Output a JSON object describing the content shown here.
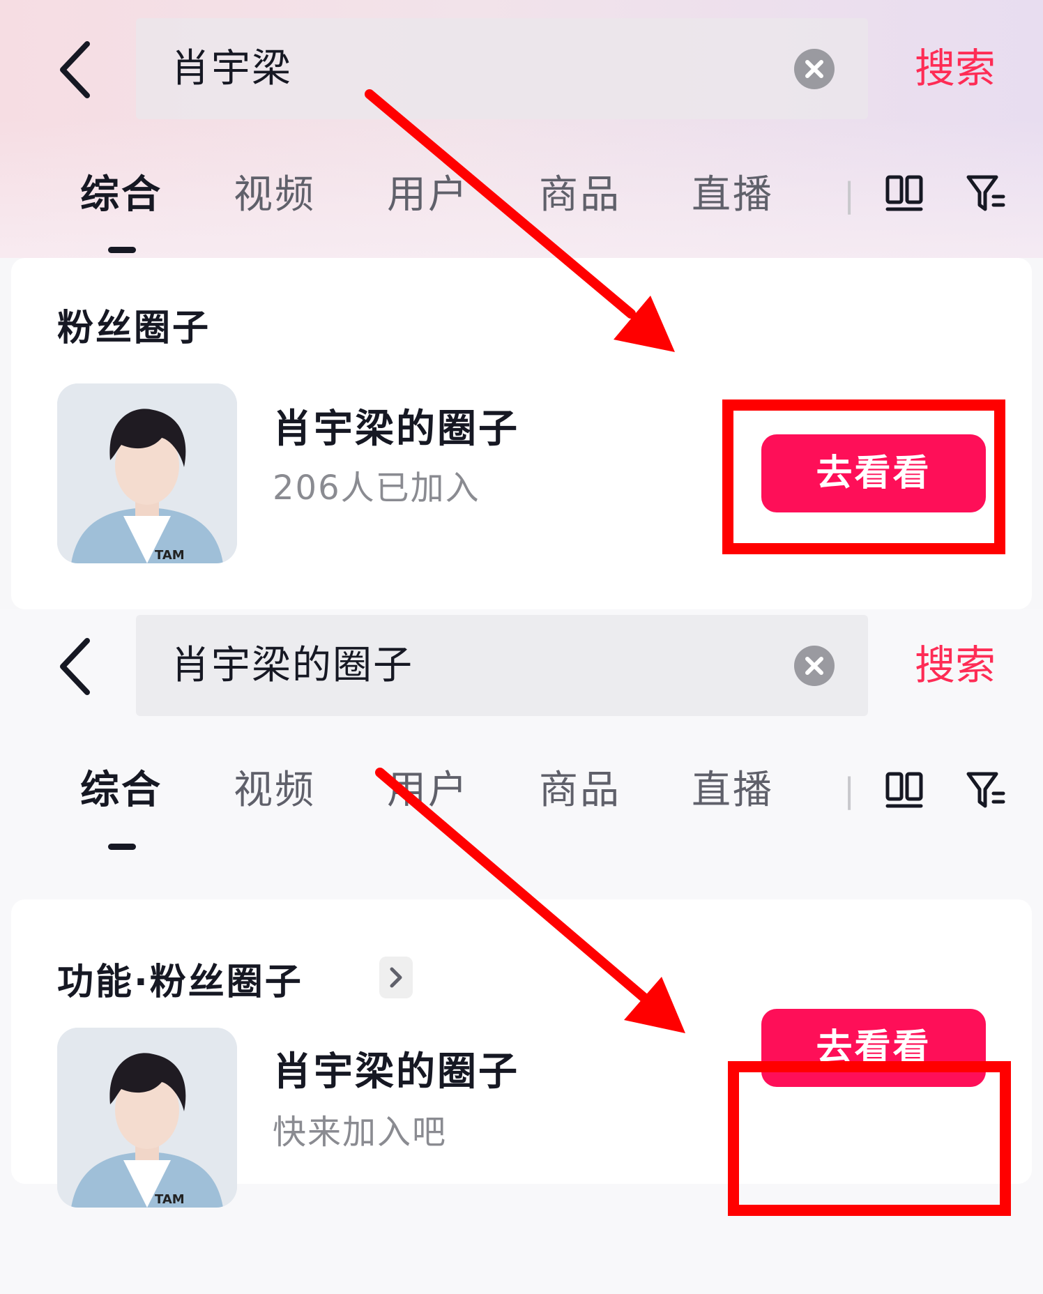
{
  "top": {
    "search": {
      "query": "肖宇梁",
      "button": "搜索"
    },
    "tabs": [
      {
        "label": "综合",
        "active": true
      },
      {
        "label": "视频"
      },
      {
        "label": "用户"
      },
      {
        "label": "商品"
      },
      {
        "label": "直播"
      }
    ],
    "section_title": "粉丝圈子",
    "circle": {
      "name": "肖宇梁的圈子",
      "subtitle": "206人已加入",
      "button": "去看看"
    }
  },
  "bottom": {
    "search": {
      "query": "肖宇梁的圈子",
      "button": "搜索"
    },
    "tabs": [
      {
        "label": "综合",
        "active": true
      },
      {
        "label": "视频"
      },
      {
        "label": "用户"
      },
      {
        "label": "商品"
      },
      {
        "label": "直播"
      }
    ],
    "section_title": "功能·粉丝圈子",
    "circle": {
      "name": "肖宇梁的圈子",
      "subtitle": "快来加入吧",
      "button": "去看看"
    }
  },
  "colors": {
    "accent": "#fe2c55",
    "button": "#fe0f58",
    "annotation": "#ff0000"
  },
  "icons": [
    "back-icon",
    "clear-icon",
    "dual-column-icon",
    "filter-icon",
    "chevron-right-icon"
  ]
}
